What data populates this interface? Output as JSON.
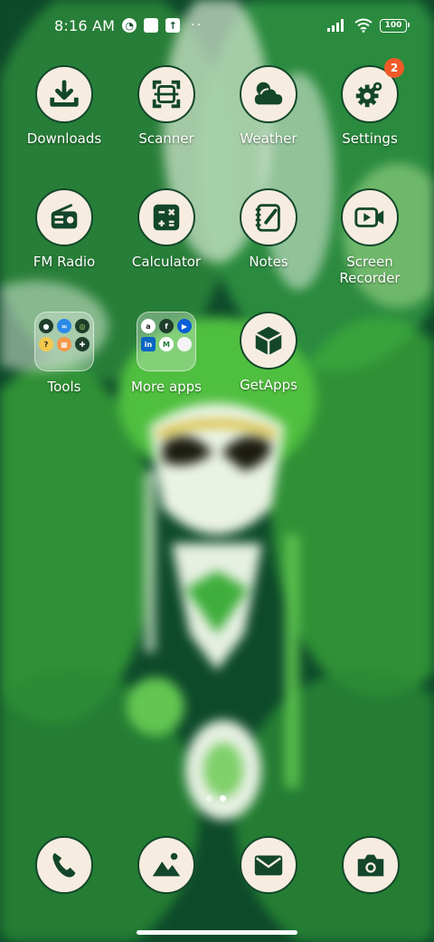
{
  "status_bar": {
    "time": "8:16 AM",
    "battery": "100",
    "icons": [
      "ring-status-icon",
      "square-notification-icon",
      "upload-notification-icon",
      "more-dots-icon",
      "signal-icon",
      "wifi-icon",
      "battery-icon"
    ]
  },
  "apps": {
    "downloads": {
      "label": "Downloads",
      "icon": "download-icon"
    },
    "scanner": {
      "label": "Scanner",
      "icon": "scan-frame-icon"
    },
    "weather": {
      "label": "Weather",
      "icon": "cloud-icon"
    },
    "settings": {
      "label": "Settings",
      "icon": "gear-icon",
      "badge": "2"
    },
    "fm_radio": {
      "label": "FM Radio",
      "icon": "radio-icon"
    },
    "calculator": {
      "label": "Calculator",
      "icon": "calculator-icon"
    },
    "notes": {
      "label": "Notes",
      "icon": "notepad-icon"
    },
    "screen_recorder": {
      "label": "Screen\nRecorder",
      "icon": "video-camera-icon"
    },
    "tools_folder": {
      "label": "Tools",
      "icon": "folder-icon"
    },
    "more_apps_folder": {
      "label": "More apps",
      "icon": "folder-icon"
    },
    "getapps": {
      "label": "GetApps",
      "icon": "box-icon"
    }
  },
  "dock": [
    "phone-icon",
    "gallery-icon",
    "mail-icon",
    "camera-icon"
  ],
  "page_indicator": {
    "pages": 2,
    "active": 2
  },
  "colors": {
    "icon_bg": "#f6ede0",
    "icon_fg": "#13462a",
    "badge": "#f05a28"
  }
}
